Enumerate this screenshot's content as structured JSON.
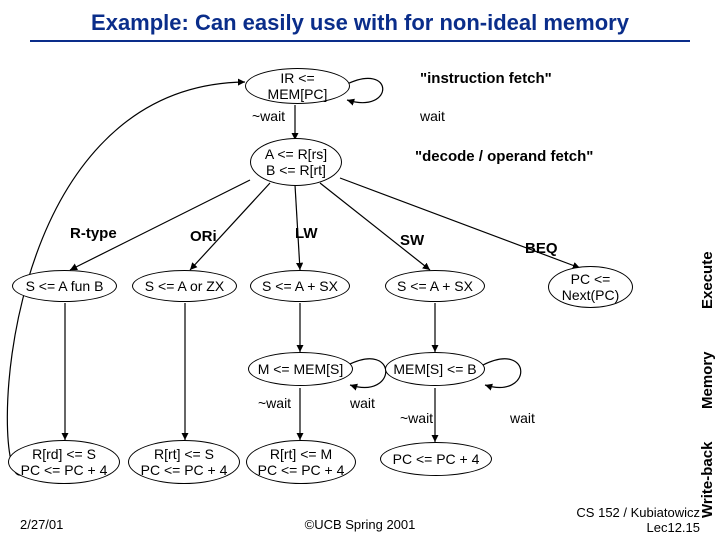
{
  "title": "Example: Can easily use with for non-ideal memory",
  "labels": {
    "ifetch": "\"instruction fetch\"",
    "decode": "\"decode / operand fetch\"",
    "rtype": "R-type",
    "ori": "ORi",
    "lw": "LW",
    "sw": "SW",
    "beq": "BEQ",
    "wait": "wait",
    "nwait": "~wait"
  },
  "nodes": {
    "n1": "IR <= MEM[PC]",
    "n2a": "A <= R[rs]",
    "n2b": "B <= R[rt]",
    "e_r": "S <= A fun B",
    "e_o": "S <= A or ZX",
    "e_lw": "S <= A + SX",
    "e_sw": "S <= A + SX",
    "e_beq_a": "PC <=",
    "e_beq_b": "Next(PC)",
    "m_lw": "M <= MEM[S]",
    "m_sw": "MEM[S] <= B",
    "wb_r_a": "R[rd] <= S",
    "wb_r_b": "PC <= PC + 4",
    "wb_o_a": "R[rt] <= S",
    "wb_o_b": "PC <= PC + 4",
    "wb_lw_a": "R[rt] <= M",
    "wb_lw_b": "PC <= PC + 4",
    "wb_sw": "PC <= PC + 4"
  },
  "stages": {
    "execute": "Execute",
    "memory": "Memory",
    "writeback": "Write-back"
  },
  "footer": {
    "date": "2/27/01",
    "center": "©UCB Spring 2001",
    "right1": "CS 152 / Kubiatowicz",
    "right2": "Lec12.15"
  }
}
